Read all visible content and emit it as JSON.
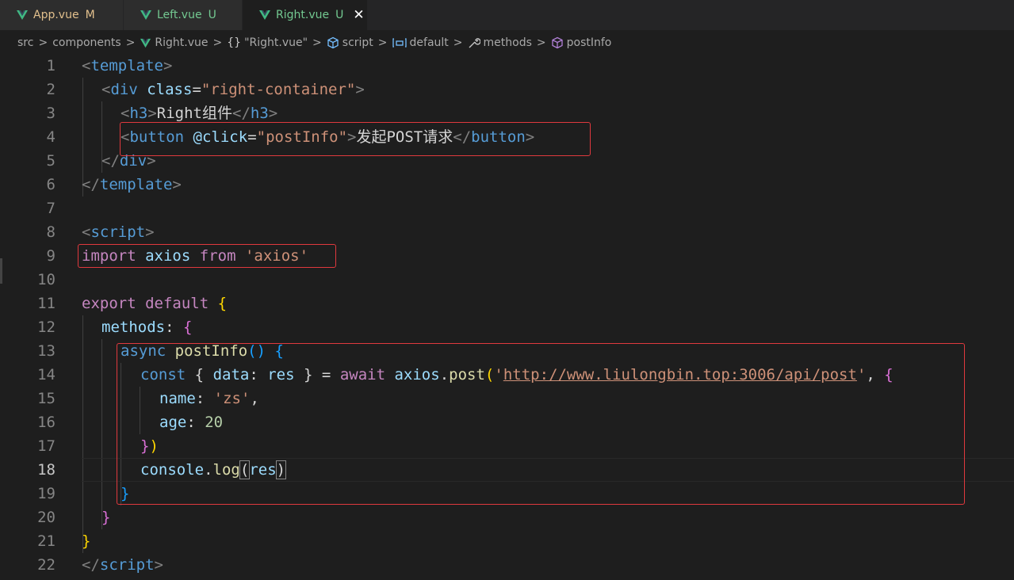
{
  "tabs": [
    {
      "name": "App.vue",
      "status": "M"
    },
    {
      "name": "Left.vue",
      "status": "U"
    },
    {
      "name": "Right.vue",
      "status": "U",
      "close": "✕"
    }
  ],
  "breadcrumb": {
    "src": "src",
    "components": "components",
    "file": "Right.vue",
    "component": "\"Right.vue\"",
    "component_prefix": "{}",
    "script": "script",
    "default": "default",
    "methods": "methods",
    "postInfo": "postInfo",
    "separator": ">"
  },
  "line_numbers": [
    "1",
    "2",
    "3",
    "4",
    "5",
    "6",
    "7",
    "8",
    "9",
    "10",
    "11",
    "12",
    "13",
    "14",
    "15",
    "16",
    "17",
    "18",
    "19",
    "20",
    "21",
    "22"
  ],
  "code": {
    "l1": [
      "<",
      "template",
      ">"
    ],
    "l2": [
      "<",
      "div",
      "class",
      "=",
      "\"right-container\"",
      ">"
    ],
    "l3": [
      "<",
      "h3",
      ">",
      "Right组件",
      "</",
      "h3",
      ">"
    ],
    "l4": [
      "<",
      "button",
      "@click",
      "=",
      "\"postInfo\"",
      ">",
      "发起POST请求",
      "</",
      "button",
      ">"
    ],
    "l5": [
      "</",
      "div",
      ">"
    ],
    "l6": [
      "</",
      "template",
      ">"
    ],
    "l8": [
      "<",
      "script",
      ">"
    ],
    "l9": [
      "import",
      "axios",
      "from",
      "'axios'"
    ],
    "l11": [
      "export",
      "default",
      "{"
    ],
    "l12": [
      "methods",
      ":",
      "{"
    ],
    "l13": [
      "async",
      "postInfo",
      "(",
      ")",
      "{"
    ],
    "l14": [
      "const",
      "{",
      "data",
      ":",
      "res",
      "}",
      "=",
      "await",
      "axios",
      ".",
      "post",
      "(",
      "'",
      "http://www.liulongbin.top:3006/api/post",
      "'",
      ",",
      "{"
    ],
    "l15": [
      "name",
      ":",
      "'zs'",
      ","
    ],
    "l16": [
      "age",
      ":",
      "20"
    ],
    "l17": [
      "}",
      ")"
    ],
    "l18": [
      "console",
      ".",
      "log",
      "(",
      "res",
      ")"
    ],
    "l19": [
      "}"
    ],
    "l20": [
      "}"
    ],
    "l21": [
      "}"
    ],
    "l22": [
      "</",
      "script",
      ">"
    ]
  },
  "colors": {
    "background": "#1e1e1e",
    "highlight_box": "#e0393e",
    "vue_green": "#41b883"
  },
  "active_line": "18"
}
